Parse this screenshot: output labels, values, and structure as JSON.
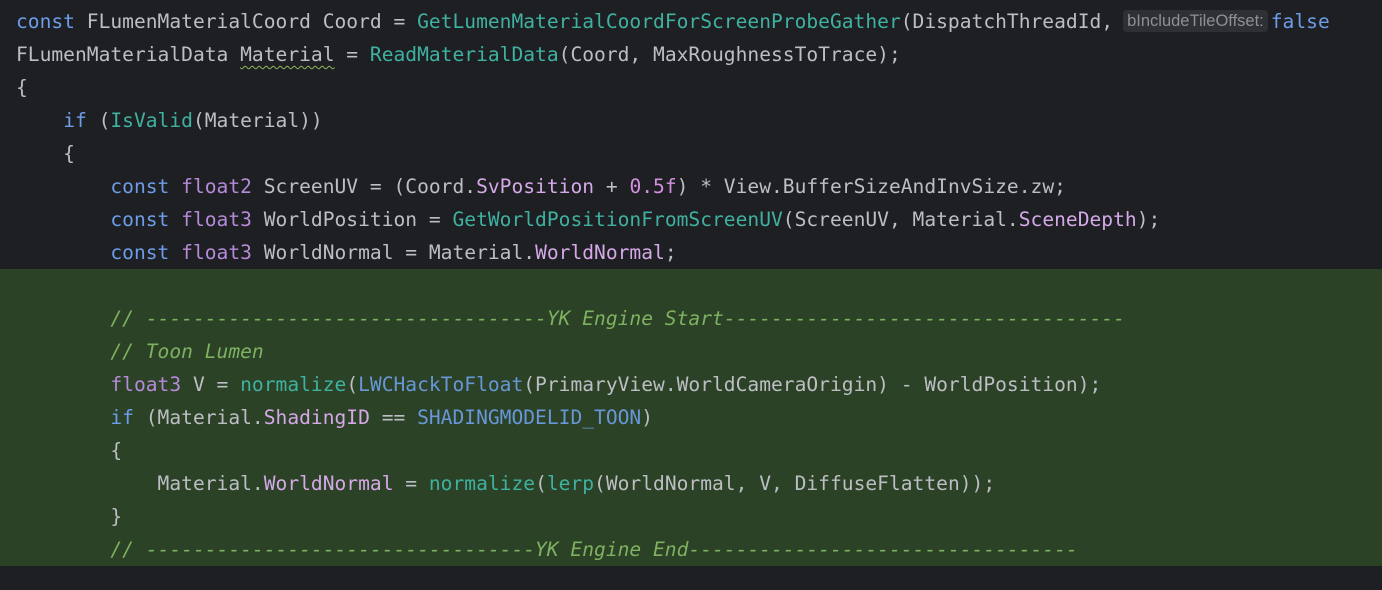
{
  "editor": {
    "lines": [
      {
        "tokens": [
          {
            "t": "const",
            "c": "kw"
          },
          {
            "t": " FLumenMaterialCoord Coord = ",
            "c": "plain"
          },
          {
            "t": "GetLumenMaterialCoordForScreenProbeGather",
            "c": "fn"
          },
          {
            "t": "(DispatchThreadId,",
            "c": "plain"
          },
          {
            "t": "bIncludeTileOffset:",
            "c": "hint"
          },
          {
            "t": "false",
            "c": "kw"
          }
        ]
      },
      {
        "tokens": [
          {
            "t": "FLumenMaterialData ",
            "c": "plain"
          },
          {
            "t": "Material",
            "c": "plain squiggle"
          },
          {
            "t": " = ",
            "c": "plain"
          },
          {
            "t": "ReadMaterialData",
            "c": "fn"
          },
          {
            "t": "(Coord, MaxRoughnessToTrace);",
            "c": "plain"
          }
        ]
      },
      {
        "tokens": [
          {
            "t": "{",
            "c": "plain"
          }
        ]
      },
      {
        "tokens": [
          {
            "t": "    ",
            "c": "plain"
          },
          {
            "t": "if",
            "c": "kw"
          },
          {
            "t": " (",
            "c": "plain"
          },
          {
            "t": "IsValid",
            "c": "fn"
          },
          {
            "t": "(Material))",
            "c": "plain"
          }
        ]
      },
      {
        "tokens": [
          {
            "t": "    {",
            "c": "plain"
          }
        ]
      },
      {
        "tokens": [
          {
            "t": "        ",
            "c": "plain"
          },
          {
            "t": "const",
            "c": "kw"
          },
          {
            "t": " ",
            "c": "plain"
          },
          {
            "t": "float2",
            "c": "ty"
          },
          {
            "t": " ScreenUV = (Coord.",
            "c": "plain"
          },
          {
            "t": "SvPosition",
            "c": "mem"
          },
          {
            "t": " + ",
            "c": "plain"
          },
          {
            "t": "0.5f",
            "c": "num"
          },
          {
            "t": ") * View.BufferSizeAndInvSize.zw;",
            "c": "plain"
          }
        ]
      },
      {
        "tokens": [
          {
            "t": "        ",
            "c": "plain"
          },
          {
            "t": "const",
            "c": "kw"
          },
          {
            "t": " ",
            "c": "plain"
          },
          {
            "t": "float3",
            "c": "ty"
          },
          {
            "t": " WorldPosition = ",
            "c": "plain"
          },
          {
            "t": "GetWorldPositionFromScreenUV",
            "c": "fn"
          },
          {
            "t": "(ScreenUV, Material.",
            "c": "plain"
          },
          {
            "t": "SceneDepth",
            "c": "mem"
          },
          {
            "t": ");",
            "c": "plain"
          }
        ]
      },
      {
        "tokens": [
          {
            "t": "        ",
            "c": "plain"
          },
          {
            "t": "const",
            "c": "kw"
          },
          {
            "t": " ",
            "c": "plain"
          },
          {
            "t": "float3",
            "c": "ty"
          },
          {
            "t": " WorldNormal = Material.",
            "c": "plain"
          },
          {
            "t": "WorldNormal",
            "c": "mem"
          },
          {
            "t": ";",
            "c": "plain"
          }
        ]
      },
      {
        "hl": true,
        "tokens": [
          {
            "t": "",
            "c": "plain"
          }
        ]
      },
      {
        "hl": true,
        "tokens": [
          {
            "t": "        ",
            "c": "plain"
          },
          {
            "t": "// ----------------------------------YK Engine Start----------------------------------",
            "c": "cm"
          }
        ]
      },
      {
        "hl": true,
        "tokens": [
          {
            "t": "        ",
            "c": "plain"
          },
          {
            "t": "// Toon Lumen",
            "c": "cm"
          }
        ]
      },
      {
        "hl": true,
        "tokens": [
          {
            "t": "        ",
            "c": "plain"
          },
          {
            "t": "float3",
            "c": "ty"
          },
          {
            "t": " V = ",
            "c": "plain"
          },
          {
            "t": "normalize",
            "c": "fn"
          },
          {
            "t": "(",
            "c": "plain"
          },
          {
            "t": "LWCHackToFloat",
            "c": "const"
          },
          {
            "t": "(PrimaryView.WorldCameraOrigin) - WorldPosition);",
            "c": "plain"
          }
        ]
      },
      {
        "hl": true,
        "tokens": [
          {
            "t": "        ",
            "c": "plain"
          },
          {
            "t": "if",
            "c": "kw"
          },
          {
            "t": " (Material.",
            "c": "plain"
          },
          {
            "t": "ShadingID",
            "c": "mem"
          },
          {
            "t": " == ",
            "c": "plain"
          },
          {
            "t": "SHADINGMODELID_TOON",
            "c": "const"
          },
          {
            "t": ")",
            "c": "plain"
          }
        ]
      },
      {
        "hl": true,
        "tokens": [
          {
            "t": "        {",
            "c": "plain"
          }
        ]
      },
      {
        "hl": true,
        "tokens": [
          {
            "t": "            Material.",
            "c": "plain"
          },
          {
            "t": "WorldNormal",
            "c": "mem"
          },
          {
            "t": " = ",
            "c": "plain"
          },
          {
            "t": "normalize",
            "c": "fn"
          },
          {
            "t": "(",
            "c": "plain"
          },
          {
            "t": "lerp",
            "c": "fn"
          },
          {
            "t": "(WorldNormal, V, DiffuseFlatten));",
            "c": "plain"
          }
        ]
      },
      {
        "hl": true,
        "tokens": [
          {
            "t": "        }",
            "c": "plain"
          }
        ]
      },
      {
        "hl": true,
        "tokens": [
          {
            "t": "        ",
            "c": "plain"
          },
          {
            "t": "// ---------------------------------YK Engine End---------------------------------",
            "c": "cm"
          }
        ]
      }
    ]
  }
}
